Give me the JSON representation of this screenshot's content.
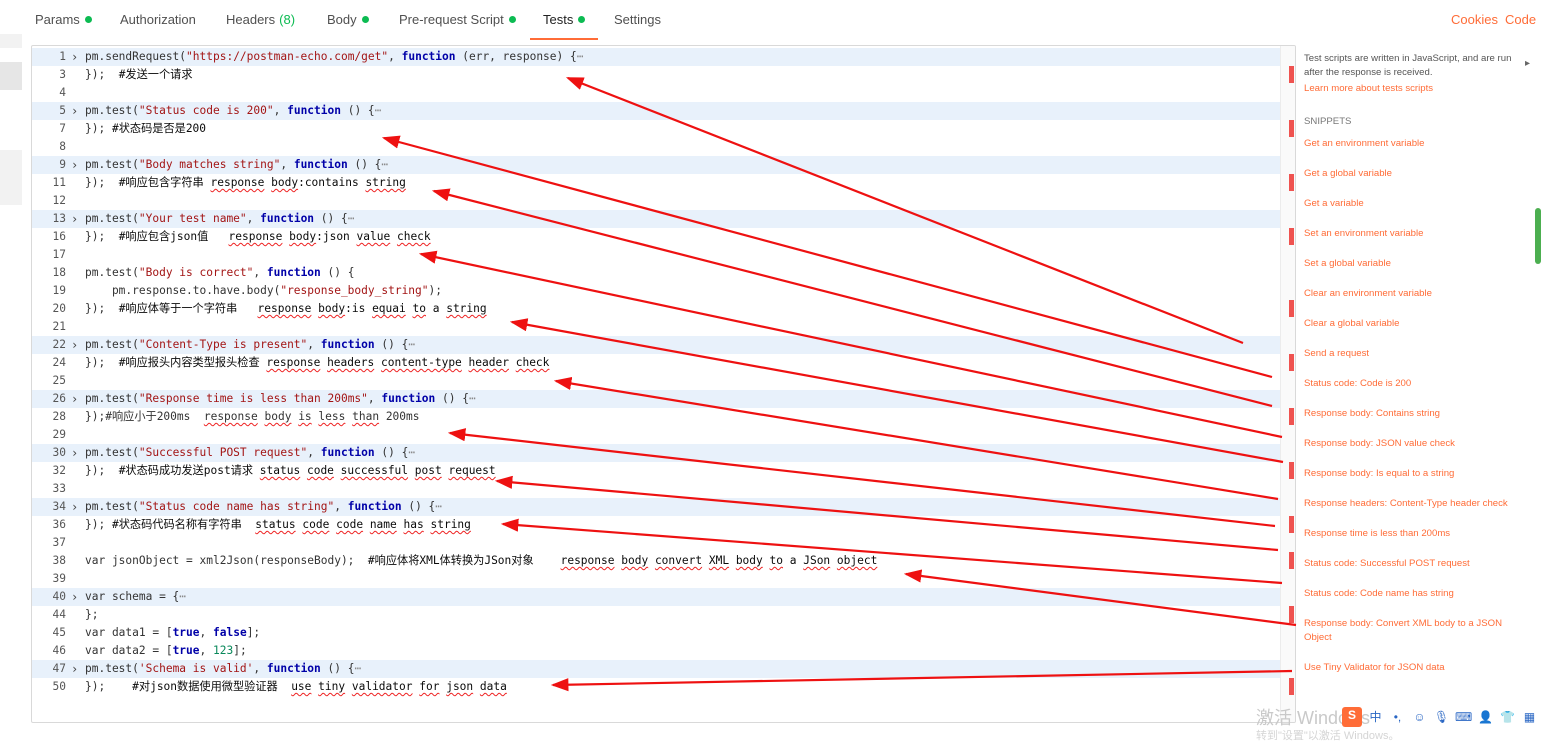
{
  "tabs": [
    {
      "label": "Params",
      "dot": true
    },
    {
      "label": "Authorization",
      "dot": false
    },
    {
      "label": "Headers",
      "count": "(8)",
      "dot": false
    },
    {
      "label": "Body",
      "dot": true
    },
    {
      "label": "Pre-request Script",
      "dot": true
    },
    {
      "label": "Tests",
      "dot": true,
      "active": true
    },
    {
      "label": "Settings",
      "dot": false
    }
  ],
  "top_links": {
    "cookies": "Cookies",
    "code": "Code"
  },
  "code_lines": [
    {
      "n": "1",
      "fold": true,
      "html": "pm.sendRequest(<span class='str'>\"https://postman-echo.com/get\"</span>, <span class='kw'>function</span> (err, response) {<span class='ell'>⋯</span>"
    },
    {
      "n": "3",
      "html": "});  <span class='cm'>#发送一个请求</span>"
    },
    {
      "n": "4",
      "html": ""
    },
    {
      "n": "5",
      "fold": true,
      "html": "pm.test(<span class='str'>\"Status code is 200\"</span>, <span class='kw'>function</span> () {<span class='ell'>⋯</span>"
    },
    {
      "n": "7",
      "html": "}); <span class='cm'>#状态码是否是200</span>"
    },
    {
      "n": "8",
      "html": ""
    },
    {
      "n": "9",
      "fold": true,
      "html": "pm.test(<span class='str'>\"Body matches string\"</span>, <span class='kw'>function</span> () {<span class='ell'>⋯</span>"
    },
    {
      "n": "11",
      "html": "});  <span class='cm'>#响应包含字符串 <span class='sq'>response</span> <span class='sq'>body</span>:contains <span class='sq'>string</span></span>"
    },
    {
      "n": "12",
      "html": ""
    },
    {
      "n": "13",
      "fold": true,
      "html": "pm.test(<span class='str'>\"Your test name\"</span>, <span class='kw'>function</span> () {<span class='ell'>⋯</span>"
    },
    {
      "n": "16",
      "html": "});  <span class='cm'>#响应包含json值   <span class='sq'>response</span> <span class='sq'>body</span>:json <span class='sq'>value</span> <span class='sq'>check</span></span>"
    },
    {
      "n": "17",
      "html": ""
    },
    {
      "n": "18",
      "html": "pm.test(<span class='str'>\"Body is correct\"</span>, <span class='kw'>function</span> () {"
    },
    {
      "n": "19",
      "html": "    pm.response.to.have.body(<span class='str'>\"response_body_string\"</span>);"
    },
    {
      "n": "20",
      "html": "});  <span class='cm'>#响应体等于一个字符串   <span class='sq'>response</span> <span class='sq'>body</span>:is <span class='sq'>equai</span> <span class='sq'>to</span> a <span class='sq'>string</span></span>"
    },
    {
      "n": "21",
      "html": ""
    },
    {
      "n": "22",
      "fold": true,
      "html": "pm.test(<span class='str'>\"Content-Type is present\"</span>, <span class='kw'>function</span> () {<span class='ell'>⋯</span>"
    },
    {
      "n": "24",
      "html": "});  <span class='cm'>#响应报头内容类型报头检查 <span class='sq'>response</span> <span class='sq'>headers</span> <span class='sq'>content-type</span> <span class='sq'>header</span> <span class='sq'>check</span></span>"
    },
    {
      "n": "25",
      "html": ""
    },
    {
      "n": "26",
      "fold": true,
      "html": "pm.test(<span class='str'>\"Response time is less than 200ms\"</span>, <span class='kw'>function</span> () {<span class='ell'>⋯</span>"
    },
    {
      "n": "28",
      "html": "});#响应小于200ms  <span class='sq'>response</span> <span class='sq'>body</span> <span class='sq'>is</span> <span class='sq'>less</span> <span class='sq'>than</span> 200ms"
    },
    {
      "n": "29",
      "html": ""
    },
    {
      "n": "30",
      "fold": true,
      "html": "pm.test(<span class='str'>\"Successful POST request\"</span>, <span class='kw'>function</span> () {<span class='ell'>⋯</span>"
    },
    {
      "n": "32",
      "html": "});  <span class='cm'>#状态码成功发送post请求 <span class='sq'>status</span> <span class='sq'>code</span> <span class='sq'>successful</span> <span class='sq'>post</span> <span class='sq'>request</span></span>"
    },
    {
      "n": "33",
      "html": ""
    },
    {
      "n": "34",
      "fold": true,
      "html": "pm.test(<span class='str'>\"Status code name has string\"</span>, <span class='kw'>function</span> () {<span class='ell'>⋯</span>"
    },
    {
      "n": "36",
      "html": "}); <span class='cm'>#状态码代码名称有字符串  <span class='sq'>status</span> <span class='sq'>code</span> <span class='sq'>code</span> <span class='sq'>name</span> <span class='sq'>has</span> <span class='sq'>string</span></span>"
    },
    {
      "n": "37",
      "html": ""
    },
    {
      "n": "38",
      "html": "var jsonObject = xml2Json(responseBody);  <span class='cm'>#响应体将XML体转换为JSon对象    <span class='sq'>response</span> <span class='sq'>body</span> <span class='sq'>convert</span> <span class='sq'>XML</span> <span class='sq'>body</span> <span class='sq'>to</span> a <span class='sq'>JSon</span> <span class='sq'>object</span></span>"
    },
    {
      "n": "39",
      "html": ""
    },
    {
      "n": "40",
      "fold": true,
      "html": "var schema = {<span class='ell'>⋯</span>"
    },
    {
      "n": "44",
      "html": "};"
    },
    {
      "n": "45",
      "html": "var data1 = [<span class='kw'>true</span>, <span class='kw'>false</span>];"
    },
    {
      "n": "46",
      "html": "var data2 = [<span class='kw'>true</span>, <span class='num'>123</span>];"
    },
    {
      "n": "47",
      "fold": true,
      "html": "pm.test(<span class='str'>'Schema is valid'</span>, <span class='kw'>function</span> () {<span class='ell'>⋯</span>"
    },
    {
      "n": "50",
      "html": "});    <span class='cm'>#对json数据使用微型验证器  <span class='sq'>use</span> <span class='sq'>tiny</span> <span class='sq'>validator</span> <span class='sq'>for</span> <span class='sq'>json</span> <span class='sq'>data</span></span>"
    }
  ],
  "sidebar": {
    "description": "Test scripts are written in JavaScript, and are run after the response is received.",
    "learn_more": "Learn more about tests scripts",
    "snippets_title": "SNIPPETS",
    "snippets": [
      "Get an environment variable",
      "Get a global variable",
      "Get a variable",
      "Set an environment variable",
      "Set a global variable",
      "Clear an environment variable",
      "Clear a global variable",
      "Send a request",
      "Status code: Code is 200",
      "Response body: Contains string",
      "Response body: JSON value check",
      "Response body: Is equal to a string",
      "Response headers: Content-Type header check",
      "Response time is less than 200ms",
      "Status code: Successful POST request",
      "Status code: Code name has string",
      "Response body: Convert XML body to a JSON Object",
      "Use Tiny Validator for JSON data"
    ]
  },
  "watermark": {
    "line1": "激活 Windows",
    "line2": "转到\"设置\"以激活 Windows。"
  },
  "tray": {
    "s": "S",
    "ime": "中",
    "icons": [
      "dot-icon",
      "smile-icon",
      "mic-icon",
      "keyboard-icon",
      "user-icon",
      "shirt-icon",
      "grid-icon"
    ]
  },
  "colors": {
    "accent": "#ff6c37",
    "green_dot": "#0cbb52",
    "fold_bg": "#e8f1fb",
    "arrow": "#ee1111"
  }
}
